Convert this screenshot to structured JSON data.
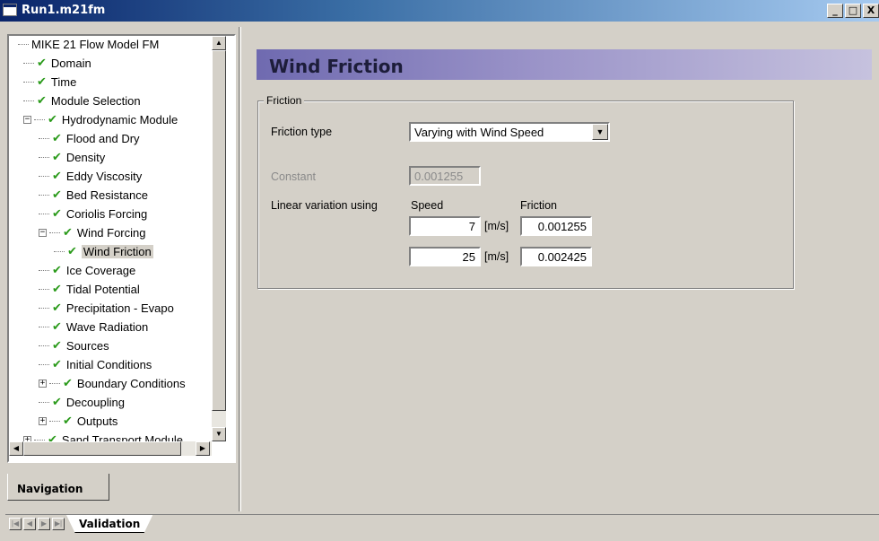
{
  "window": {
    "title": "Run1.m21fm",
    "minimize_label": "_",
    "maximize_label": "□",
    "close_label": "X"
  },
  "navigation": {
    "tab_label": "Navigation",
    "tree": [
      {
        "label": "MIKE 21 Flow Model FM",
        "checked": false
      },
      {
        "label": "Domain",
        "checked": true
      },
      {
        "label": "Time",
        "checked": true
      },
      {
        "label": "Module Selection",
        "checked": true
      },
      {
        "label": "Hydrodynamic Module",
        "checked": true,
        "expander": "−"
      },
      {
        "label": "Flood and Dry",
        "checked": true
      },
      {
        "label": "Density",
        "checked": true
      },
      {
        "label": "Eddy Viscosity",
        "checked": true
      },
      {
        "label": "Bed Resistance",
        "checked": true
      },
      {
        "label": "Coriolis Forcing",
        "checked": true
      },
      {
        "label": "Wind Forcing",
        "checked": true,
        "expander": "−"
      },
      {
        "label": "Wind Friction",
        "checked": true,
        "selected": true
      },
      {
        "label": "Ice Coverage",
        "checked": true
      },
      {
        "label": "Tidal Potential",
        "checked": true
      },
      {
        "label": "Precipitation - Evapo",
        "checked": true
      },
      {
        "label": "Wave Radiation",
        "checked": true
      },
      {
        "label": "Sources",
        "checked": true
      },
      {
        "label": "Initial Conditions",
        "checked": true
      },
      {
        "label": "Boundary Conditions",
        "checked": true,
        "expander": "+"
      },
      {
        "label": "Decoupling",
        "checked": true
      },
      {
        "label": "Outputs",
        "checked": true,
        "expander": "+"
      },
      {
        "label": "Sand Transport Module",
        "checked": true,
        "expander": "+"
      }
    ],
    "check_glyph": "✔"
  },
  "main": {
    "heading": "Wind Friction",
    "group_label": "Friction",
    "friction_type_label": "Friction type",
    "friction_type_value": "Varying with Wind Speed",
    "constant_label": "Constant",
    "constant_value": "0.001255",
    "linear_label": "Linear variation using",
    "speed_header": "Speed",
    "friction_header": "Friction",
    "rows": [
      {
        "speed": "7",
        "unit": "[m/s]",
        "friction": "0.001255"
      },
      {
        "speed": "25",
        "unit": "[m/s]",
        "friction": "0.002425"
      }
    ]
  },
  "bottom": {
    "tab_label": "Validation"
  },
  "colors": {
    "title_bar": "#0a246a",
    "header_band": "#8d87c0",
    "check": "#2a9a1a"
  }
}
